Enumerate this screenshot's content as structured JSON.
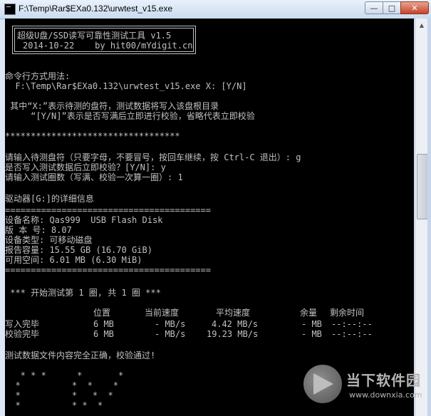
{
  "window": {
    "title": "F:\\Temp\\Rar$EXa0.132\\urwtest_v15.exe",
    "minimize_label": "—",
    "maximize_label": "□",
    "close_label": "✕"
  },
  "console": {
    "header_line1": "超级U盘/SSD读写可靠性测试工具 v1.5",
    "header_line2": "2014-10-22    by hit00/mYdigit.cn",
    "usage_title": "命令行方式用法:",
    "usage_cmd": "  F:\\Temp\\Rar$EXa0.132\\urwtest_v15.exe X: [Y/N]",
    "usage_desc1": " 其中“X:”表示待测的盘符，测试数据将写入该盘根目录",
    "usage_desc2": "     “[Y/N]”表示是否写满后立即进行校验，省略代表立即校验",
    "stars": "**********************************",
    "prompt_drive": "请输入待测盘符（只要字母，不要冒号，按回车继续，按 Ctrl-C 退出）: g",
    "prompt_verify": "是否写入测试数据后立即校验？[Y/N]: y",
    "prompt_rounds": "请输入测试圈数（写满、校验一次算一圈）: 1",
    "drive_detail_title": "驱动器[G:]的详细信息",
    "separator": "========================================",
    "device_name": "设备名称: Qas999  USB Flash Disk",
    "version": "版 本 号: 8.07",
    "device_type": "设备类型: 可移动磁盘",
    "reported_capacity": "报告容量: 15.55 GB (16.70 GiB)",
    "free_space": "可用空间: 6.01 MB (6.30 MiB)",
    "round_start": " *** 开始测试第 1 圈, 共 1 圈 ***",
    "table": {
      "headers": [
        "位置",
        "当前速度",
        "平均速度",
        "余量",
        "剩余时间"
      ],
      "rows": [
        {
          "label": "写入完毕",
          "pos": "6 MB",
          "cur": "- MB/s",
          "avg": "4.42 MB/s",
          "rem": "- MB",
          "time": "--:--:--"
        },
        {
          "label": "校验完毕",
          "pos": "6 MB",
          "cur": "- MB/s",
          "avg": "19.23 MB/s",
          "rem": "- MB",
          "time": "--:--:--"
        }
      ]
    },
    "result": "测试数据文件内容完全正确，校验通过!",
    "ascii_art": [
      "   * * *      *       *",
      "  *          *  *    *",
      "  *          *   *  *",
      "  *          * *  *"
    ]
  },
  "watermark": {
    "title": "当下软件园",
    "url": "www.downxia.com"
  },
  "colors": {
    "console_bg": "#000000",
    "console_text": "#c0c0c0",
    "titlebar": "#dbe7f4",
    "close_button": "#c7432a"
  }
}
